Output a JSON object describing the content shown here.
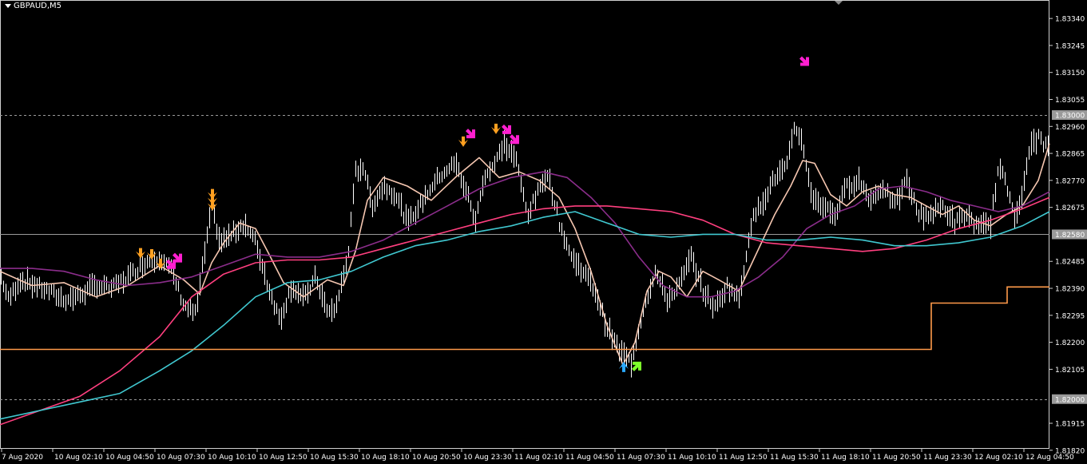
{
  "chart_data": {
    "type": "line",
    "title": "",
    "symbol": "GBPAUD,M5",
    "background": "#000000",
    "ylim": [
      1.81825,
      1.83405
    ],
    "x_ticks": [
      "7 Aug 2020",
      "10 Aug 02:10",
      "10 Aug 04:50",
      "10 Aug 07:30",
      "10 Aug 10:10",
      "10 Aug 12:50",
      "10 Aug 15:30",
      "10 Aug 18:10",
      "10 Aug 20:50",
      "10 Aug 23:30",
      "11 Aug 02:10",
      "11 Aug 04:50",
      "11 Aug 07:30",
      "11 Aug 10:10",
      "11 Aug 12:50",
      "11 Aug 15:30",
      "11 Aug 18:10",
      "11 Aug 20:50",
      "11 Aug 23:30",
      "12 Aug 02:10",
      "12 Aug 04:50"
    ],
    "y_ticks": [
      1.8334,
      1.83245,
      1.8315,
      1.83055,
      1.8296,
      1.82865,
      1.8277,
      1.82675,
      1.82485,
      1.8239,
      1.82295,
      1.822,
      1.82105,
      1.81915,
      1.8182
    ],
    "y_tick_labels": [
      "1.83340",
      "1.83245",
      "1.83150",
      "1.83055",
      "1.82960",
      "1.82865",
      "1.82770",
      "1.82675",
      "1.82485",
      "1.82390",
      "1.82295",
      "1.82200",
      "1.82105",
      "1.81915",
      "1.81820"
    ],
    "price_labels": [
      {
        "label": "1.83000",
        "value": 1.83
      },
      {
        "label": "1.82580",
        "value": 1.8258
      },
      {
        "label": "1.82000",
        "value": 1.82
      }
    ],
    "price_lines": [
      1.83,
      1.8258,
      1.82
    ],
    "colors": {
      "candles": "#ffffff",
      "fast_ma": "#f5c6b0",
      "purple_ma": "#8b2d8b",
      "pink_ma": "#ff3f7f",
      "cyan_ma": "#40c8d0",
      "stop_line": "#ff9a4a",
      "grid": "#9a9a9a",
      "axis_text": "#ffffff",
      "label_box": "#9a9a9a",
      "arrow_orange": "#ffa020",
      "arrow_magenta": "#ff1fd0",
      "arrow_blue": "#2aa9ff",
      "arrow_green": "#7dff2a"
    },
    "series": [
      {
        "color_key": "fast_ma",
        "values": [
          [
            0,
            1.8245
          ],
          [
            40,
            1.824
          ],
          [
            80,
            1.8241
          ],
          [
            120,
            1.8236
          ],
          [
            160,
            1.824
          ],
          [
            200,
            1.8247
          ],
          [
            230,
            1.8242
          ],
          [
            250,
            1.8237
          ],
          [
            265,
            1.8248
          ],
          [
            280,
            1.8255
          ],
          [
            300,
            1.8262
          ],
          [
            320,
            1.826
          ],
          [
            335,
            1.8252
          ],
          [
            355,
            1.8241
          ],
          [
            380,
            1.8236
          ],
          [
            410,
            1.8242
          ],
          [
            430,
            1.824
          ],
          [
            445,
            1.8252
          ],
          [
            460,
            1.827
          ],
          [
            480,
            1.8278
          ],
          [
            510,
            1.8275
          ],
          [
            540,
            1.827
          ],
          [
            570,
            1.8278
          ],
          [
            600,
            1.8285
          ],
          [
            625,
            1.8278
          ],
          [
            650,
            1.828
          ],
          [
            675,
            1.8277
          ],
          [
            700,
            1.8271
          ],
          [
            720,
            1.826
          ],
          [
            740,
            1.8245
          ],
          [
            760,
            1.8226
          ],
          [
            780,
            1.8212
          ],
          [
            795,
            1.822
          ],
          [
            810,
            1.8238
          ],
          [
            825,
            1.8245
          ],
          [
            840,
            1.8243
          ],
          [
            860,
            1.8236
          ],
          [
            880,
            1.8245
          ],
          [
            900,
            1.8242
          ],
          [
            925,
            1.8238
          ],
          [
            945,
            1.825
          ],
          [
            970,
            1.8265
          ],
          [
            990,
            1.8275
          ],
          [
            1005,
            1.8284
          ],
          [
            1020,
            1.8283
          ],
          [
            1040,
            1.8272
          ],
          [
            1060,
            1.8268
          ],
          [
            1080,
            1.8273
          ],
          [
            1100,
            1.8275
          ],
          [
            1120,
            1.8272
          ],
          [
            1140,
            1.8271
          ],
          [
            1160,
            1.8268
          ],
          [
            1180,
            1.8265
          ],
          [
            1200,
            1.8268
          ],
          [
            1220,
            1.8263
          ],
          [
            1240,
            1.8261
          ],
          [
            1260,
            1.8265
          ],
          [
            1280,
            1.8268
          ],
          [
            1300,
            1.8277
          ],
          [
            1314,
            1.829
          ]
        ]
      },
      {
        "color_key": "purple_ma",
        "values": [
          [
            0,
            1.8246
          ],
          [
            40,
            1.8246
          ],
          [
            80,
            1.8245
          ],
          [
            120,
            1.8242
          ],
          [
            160,
            1.824
          ],
          [
            200,
            1.8241
          ],
          [
            240,
            1.8243
          ],
          [
            280,
            1.8247
          ],
          [
            320,
            1.8251
          ],
          [
            360,
            1.825
          ],
          [
            400,
            1.825
          ],
          [
            440,
            1.8252
          ],
          [
            480,
            1.8256
          ],
          [
            520,
            1.8262
          ],
          [
            560,
            1.8268
          ],
          [
            600,
            1.8274
          ],
          [
            640,
            1.8278
          ],
          [
            680,
            1.828
          ],
          [
            710,
            1.8278
          ],
          [
            740,
            1.8271
          ],
          [
            770,
            1.8262
          ],
          [
            800,
            1.825
          ],
          [
            830,
            1.824
          ],
          [
            860,
            1.8236
          ],
          [
            890,
            1.8236
          ],
          [
            920,
            1.8238
          ],
          [
            950,
            1.8243
          ],
          [
            980,
            1.825
          ],
          [
            1010,
            1.826
          ],
          [
            1040,
            1.8265
          ],
          [
            1070,
            1.8268
          ],
          [
            1100,
            1.8274
          ],
          [
            1130,
            1.8275
          ],
          [
            1160,
            1.8273
          ],
          [
            1190,
            1.827
          ],
          [
            1220,
            1.8268
          ],
          [
            1250,
            1.8266
          ],
          [
            1280,
            1.8268
          ],
          [
            1314,
            1.8273
          ]
        ]
      },
      {
        "color_key": "pink_ma",
        "values": [
          [
            0,
            1.8191
          ],
          [
            50,
            1.8196
          ],
          [
            100,
            1.8201
          ],
          [
            150,
            1.821
          ],
          [
            200,
            1.8222
          ],
          [
            240,
            1.8236
          ],
          [
            280,
            1.8244
          ],
          [
            320,
            1.8248
          ],
          [
            360,
            1.8249
          ],
          [
            400,
            1.8249
          ],
          [
            440,
            1.825
          ],
          [
            480,
            1.8253
          ],
          [
            520,
            1.8256
          ],
          [
            560,
            1.8259
          ],
          [
            600,
            1.8262
          ],
          [
            640,
            1.8265
          ],
          [
            680,
            1.8267
          ],
          [
            720,
            1.8268
          ],
          [
            760,
            1.8268
          ],
          [
            800,
            1.8267
          ],
          [
            840,
            1.8266
          ],
          [
            880,
            1.8263
          ],
          [
            920,
            1.8258
          ],
          [
            960,
            1.8255
          ],
          [
            1000,
            1.8254
          ],
          [
            1040,
            1.8253
          ],
          [
            1080,
            1.8252
          ],
          [
            1120,
            1.8253
          ],
          [
            1160,
            1.8256
          ],
          [
            1200,
            1.826
          ],
          [
            1240,
            1.8263
          ],
          [
            1280,
            1.8267
          ],
          [
            1314,
            1.8271
          ]
        ]
      },
      {
        "color_key": "cyan_ma",
        "values": [
          [
            0,
            1.8193
          ],
          [
            50,
            1.8196
          ],
          [
            100,
            1.8199
          ],
          [
            150,
            1.8202
          ],
          [
            200,
            1.821
          ],
          [
            240,
            1.8217
          ],
          [
            280,
            1.8226
          ],
          [
            320,
            1.8236
          ],
          [
            360,
            1.8241
          ],
          [
            400,
            1.8242
          ],
          [
            440,
            1.8245
          ],
          [
            480,
            1.825
          ],
          [
            520,
            1.8254
          ],
          [
            560,
            1.8256
          ],
          [
            600,
            1.8259
          ],
          [
            640,
            1.8261
          ],
          [
            680,
            1.8264
          ],
          [
            720,
            1.8266
          ],
          [
            760,
            1.8262
          ],
          [
            800,
            1.8258
          ],
          [
            840,
            1.8257
          ],
          [
            880,
            1.8258
          ],
          [
            920,
            1.8258
          ],
          [
            960,
            1.8256
          ],
          [
            1000,
            1.8256
          ],
          [
            1040,
            1.8257
          ],
          [
            1080,
            1.8256
          ],
          [
            1120,
            1.8254
          ],
          [
            1160,
            1.8254
          ],
          [
            1200,
            1.8255
          ],
          [
            1240,
            1.8257
          ],
          [
            1280,
            1.8261
          ],
          [
            1314,
            1.8266
          ]
        ]
      }
    ],
    "stop_steps": [
      [
        0,
        1.82175
      ],
      [
        1166,
        1.82175
      ],
      [
        1166,
        1.82338
      ],
      [
        1261,
        1.82338
      ],
      [
        1261,
        1.82395
      ],
      [
        1314,
        1.82395
      ]
    ],
    "candle_segments": [
      [
        0,
        1.8244
      ],
      [
        10,
        1.8235
      ],
      [
        25,
        1.8242
      ],
      [
        45,
        1.824
      ],
      [
        60,
        1.8238
      ],
      [
        80,
        1.8235
      ],
      [
        95,
        1.8236
      ],
      [
        120,
        1.824
      ],
      [
        140,
        1.8239
      ],
      [
        160,
        1.8243
      ],
      [
        180,
        1.8248
      ],
      [
        200,
        1.825
      ],
      [
        215,
        1.8245
      ],
      [
        230,
        1.8233
      ],
      [
        245,
        1.823
      ],
      [
        255,
        1.825
      ],
      [
        265,
        1.8268
      ],
      [
        275,
        1.8255
      ],
      [
        290,
        1.8258
      ],
      [
        305,
        1.8262
      ],
      [
        320,
        1.8255
      ],
      [
        335,
        1.824
      ],
      [
        350,
        1.8228
      ],
      [
        365,
        1.824
      ],
      [
        380,
        1.8235
      ],
      [
        395,
        1.8243
      ],
      [
        410,
        1.823
      ],
      [
        420,
        1.8232
      ],
      [
        435,
        1.825
      ],
      [
        445,
        1.828
      ],
      [
        455,
        1.8282
      ],
      [
        465,
        1.8268
      ],
      [
        480,
        1.8275
      ],
      [
        495,
        1.8272
      ],
      [
        510,
        1.8262
      ],
      [
        525,
        1.8268
      ],
      [
        540,
        1.8275
      ],
      [
        555,
        1.828
      ],
      [
        570,
        1.8283
      ],
      [
        585,
        1.8272
      ],
      [
        595,
        1.8262
      ],
      [
        605,
        1.8278
      ],
      [
        620,
        1.8283
      ],
      [
        630,
        1.829
      ],
      [
        645,
        1.8285
      ],
      [
        660,
        1.8265
      ],
      [
        672,
        1.8272
      ],
      [
        685,
        1.828
      ],
      [
        700,
        1.8262
      ],
      [
        715,
        1.825
      ],
      [
        730,
        1.8245
      ],
      [
        745,
        1.8238
      ],
      [
        760,
        1.8225
      ],
      [
        775,
        1.8217
      ],
      [
        790,
        1.8213
      ],
      [
        805,
        1.8232
      ],
      [
        820,
        1.8245
      ],
      [
        835,
        1.8235
      ],
      [
        850,
        1.824
      ],
      [
        865,
        1.825
      ],
      [
        880,
        1.8238
      ],
      [
        895,
        1.8232
      ],
      [
        910,
        1.824
      ],
      [
        925,
        1.8235
      ],
      [
        940,
        1.8262
      ],
      [
        955,
        1.827
      ],
      [
        970,
        1.8278
      ],
      [
        985,
        1.8282
      ],
      [
        995,
        1.8296
      ],
      [
        1005,
        1.829
      ],
      [
        1015,
        1.8272
      ],
      [
        1030,
        1.8268
      ],
      [
        1045,
        1.8265
      ],
      [
        1060,
        1.8275
      ],
      [
        1075,
        1.8277
      ],
      [
        1090,
        1.827
      ],
      [
        1105,
        1.8275
      ],
      [
        1120,
        1.8268
      ],
      [
        1135,
        1.8277
      ],
      [
        1150,
        1.8265
      ],
      [
        1165,
        1.8265
      ],
      [
        1180,
        1.8268
      ],
      [
        1195,
        1.8262
      ],
      [
        1210,
        1.8265
      ],
      [
        1225,
        1.826
      ],
      [
        1240,
        1.8262
      ],
      [
        1250,
        1.8282
      ],
      [
        1260,
        1.8275
      ],
      [
        1270,
        1.8265
      ],
      [
        1280,
        1.8272
      ],
      [
        1290,
        1.829
      ],
      [
        1300,
        1.8292
      ],
      [
        1314,
        1.8288
      ]
    ],
    "signals": [
      {
        "kind": "down",
        "color_key": "arrow_orange",
        "x": 176,
        "value": 1.82512,
        "count": 1
      },
      {
        "kind": "down",
        "color_key": "arrow_orange",
        "x": 190,
        "value": 1.82508,
        "count": 1
      },
      {
        "kind": "down",
        "color_key": "arrow_orange",
        "x": 201,
        "value": 1.82475,
        "count": 1
      },
      {
        "kind": "downdiag",
        "color_key": "arrow_magenta",
        "x": 214,
        "value": 1.82475,
        "count": 1
      },
      {
        "kind": "downdiag",
        "color_key": "arrow_magenta",
        "x": 222,
        "value": 1.82498,
        "count": 1
      },
      {
        "kind": "down",
        "color_key": "arrow_orange",
        "x": 266,
        "value": 1.8272,
        "count": 3
      },
      {
        "kind": "down",
        "color_key": "arrow_orange",
        "x": 580,
        "value": 1.82905,
        "count": 1
      },
      {
        "kind": "downdiag",
        "color_key": "arrow_magenta",
        "x": 589,
        "value": 1.82935,
        "count": 1
      },
      {
        "kind": "down",
        "color_key": "arrow_orange",
        "x": 621,
        "value": 1.8295,
        "count": 1
      },
      {
        "kind": "downdiag",
        "color_key": "arrow_magenta",
        "x": 634,
        "value": 1.8295,
        "count": 1
      },
      {
        "kind": "downdiag",
        "color_key": "arrow_magenta",
        "x": 644,
        "value": 1.82915,
        "count": 1
      },
      {
        "kind": "downdiag",
        "color_key": "arrow_magenta",
        "x": 1007,
        "value": 1.8319,
        "count": 1
      },
      {
        "kind": "up",
        "color_key": "arrow_blue",
        "x": 781,
        "value": 1.82115,
        "count": 1
      },
      {
        "kind": "updiag",
        "color_key": "arrow_green",
        "x": 797,
        "value": 1.82115,
        "count": 1
      }
    ]
  }
}
